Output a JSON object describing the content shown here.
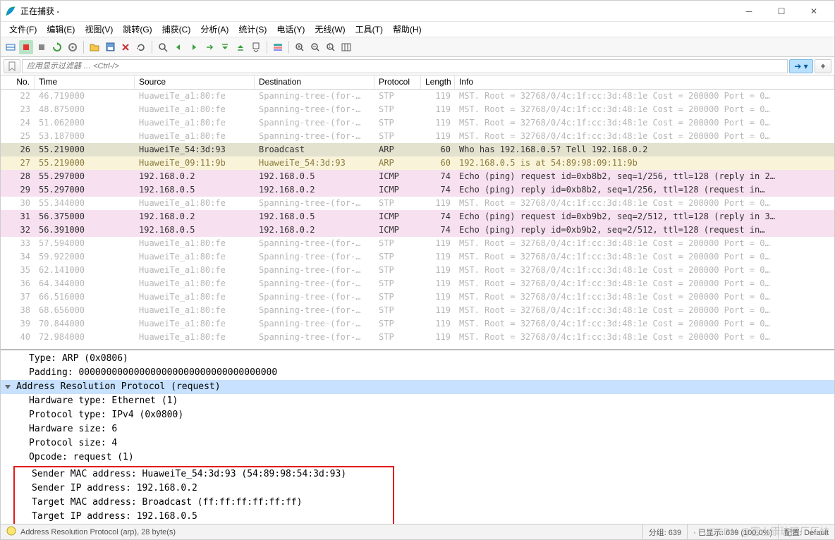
{
  "window": {
    "title": "正在捕获 -"
  },
  "menu": [
    "文件(F)",
    "编辑(E)",
    "视图(V)",
    "跳转(G)",
    "捕获(C)",
    "分析(A)",
    "统计(S)",
    "电话(Y)",
    "无线(W)",
    "工具(T)",
    "帮助(H)"
  ],
  "filter": {
    "placeholder": "应用显示过滤器 … <Ctrl-/>"
  },
  "columns": [
    "No.",
    "Time",
    "Source",
    "Destination",
    "Protocol",
    "Length",
    "Info"
  ],
  "packets": [
    {
      "no": "22",
      "time": "46.719000",
      "src": "HuaweiTe_a1:80:fe",
      "dst": "Spanning-tree-(for-…",
      "proto": "STP",
      "len": "119",
      "info": "MST. Root = 32768/0/4c:1f:cc:3d:48:1e  Cost = 200000  Port = 0…",
      "cls": "dim"
    },
    {
      "no": "23",
      "time": "48.875000",
      "src": "HuaweiTe_a1:80:fe",
      "dst": "Spanning-tree-(for-…",
      "proto": "STP",
      "len": "119",
      "info": "MST. Root = 32768/0/4c:1f:cc:3d:48:1e  Cost = 200000  Port = 0…",
      "cls": "dim"
    },
    {
      "no": "24",
      "time": "51.062000",
      "src": "HuaweiTe_a1:80:fe",
      "dst": "Spanning-tree-(for-…",
      "proto": "STP",
      "len": "119",
      "info": "MST. Root = 32768/0/4c:1f:cc:3d:48:1e  Cost = 200000  Port = 0…",
      "cls": "dim"
    },
    {
      "no": "25",
      "time": "53.187000",
      "src": "HuaweiTe_a1:80:fe",
      "dst": "Spanning-tree-(for-…",
      "proto": "STP",
      "len": "119",
      "info": "MST. Root = 32768/0/4c:1f:cc:3d:48:1e  Cost = 200000  Port = 0…",
      "cls": "dim"
    },
    {
      "no": "26",
      "time": "55.219000",
      "src": "HuaweiTe_54:3d:93",
      "dst": "Broadcast",
      "proto": "ARP",
      "len": "60",
      "info": "Who has 192.168.0.5? Tell 192.168.0.2",
      "cls": "arp0"
    },
    {
      "no": "27",
      "time": "55.219000",
      "src": "HuaweiTe_09:11:9b",
      "dst": "HuaweiTe_54:3d:93",
      "proto": "ARP",
      "len": "60",
      "info": "192.168.0.5 is at 54:89:98:09:11:9b",
      "cls": "arp1"
    },
    {
      "no": "28",
      "time": "55.297000",
      "src": "192.168.0.2",
      "dst": "192.168.0.5",
      "proto": "ICMP",
      "len": "74",
      "info": "Echo (ping) request  id=0xb8b2, seq=1/256, ttl=128 (reply in 2…",
      "cls": "icmp"
    },
    {
      "no": "29",
      "time": "55.297000",
      "src": "192.168.0.5",
      "dst": "192.168.0.2",
      "proto": "ICMP",
      "len": "74",
      "info": "Echo (ping) reply    id=0xb8b2, seq=1/256, ttl=128 (request in…",
      "cls": "icmp"
    },
    {
      "no": "30",
      "time": "55.344000",
      "src": "HuaweiTe_a1:80:fe",
      "dst": "Spanning-tree-(for-…",
      "proto": "STP",
      "len": "119",
      "info": "MST. Root = 32768/0/4c:1f:cc:3d:48:1e  Cost = 200000  Port = 0…",
      "cls": "dim"
    },
    {
      "no": "31",
      "time": "56.375000",
      "src": "192.168.0.2",
      "dst": "192.168.0.5",
      "proto": "ICMP",
      "len": "74",
      "info": "Echo (ping) request  id=0xb9b2, seq=2/512, ttl=128 (reply in 3…",
      "cls": "icmp"
    },
    {
      "no": "32",
      "time": "56.391000",
      "src": "192.168.0.5",
      "dst": "192.168.0.2",
      "proto": "ICMP",
      "len": "74",
      "info": "Echo (ping) reply    id=0xb9b2, seq=2/512, ttl=128 (request in…",
      "cls": "icmp"
    },
    {
      "no": "33",
      "time": "57.594000",
      "src": "HuaweiTe_a1:80:fe",
      "dst": "Spanning-tree-(for-…",
      "proto": "STP",
      "len": "119",
      "info": "MST. Root = 32768/0/4c:1f:cc:3d:48:1e  Cost = 200000  Port = 0…",
      "cls": "dim"
    },
    {
      "no": "34",
      "time": "59.922000",
      "src": "HuaweiTe_a1:80:fe",
      "dst": "Spanning-tree-(for-…",
      "proto": "STP",
      "len": "119",
      "info": "MST. Root = 32768/0/4c:1f:cc:3d:48:1e  Cost = 200000  Port = 0…",
      "cls": "dim"
    },
    {
      "no": "35",
      "time": "62.141000",
      "src": "HuaweiTe_a1:80:fe",
      "dst": "Spanning-tree-(for-…",
      "proto": "STP",
      "len": "119",
      "info": "MST. Root = 32768/0/4c:1f:cc:3d:48:1e  Cost = 200000  Port = 0…",
      "cls": "dim"
    },
    {
      "no": "36",
      "time": "64.344000",
      "src": "HuaweiTe_a1:80:fe",
      "dst": "Spanning-tree-(for-…",
      "proto": "STP",
      "len": "119",
      "info": "MST. Root = 32768/0/4c:1f:cc:3d:48:1e  Cost = 200000  Port = 0…",
      "cls": "dim"
    },
    {
      "no": "37",
      "time": "66.516000",
      "src": "HuaweiTe_a1:80:fe",
      "dst": "Spanning-tree-(for-…",
      "proto": "STP",
      "len": "119",
      "info": "MST. Root = 32768/0/4c:1f:cc:3d:48:1e  Cost = 200000  Port = 0…",
      "cls": "dim"
    },
    {
      "no": "38",
      "time": "68.656000",
      "src": "HuaweiTe_a1:80:fe",
      "dst": "Spanning-tree-(for-…",
      "proto": "STP",
      "len": "119",
      "info": "MST. Root = 32768/0/4c:1f:cc:3d:48:1e  Cost = 200000  Port = 0…",
      "cls": "dim"
    },
    {
      "no": "39",
      "time": "70.844000",
      "src": "HuaweiTe_a1:80:fe",
      "dst": "Spanning-tree-(for-…",
      "proto": "STP",
      "len": "119",
      "info": "MST. Root = 32768/0/4c:1f:cc:3d:48:1e  Cost = 200000  Port = 0…",
      "cls": "dim"
    },
    {
      "no": "40",
      "time": "72.984000",
      "src": "HuaweiTe_a1:80:fe",
      "dst": "Spanning-tree-(for-…",
      "proto": "STP",
      "len": "119",
      "info": "MST. Root = 32768/0/4c:1f:cc:3d:48:1e  Cost = 200000  Port = 0…",
      "cls": "dim"
    }
  ],
  "details_top": [
    "Type: ARP (0x0806)",
    "Padding: 000000000000000000000000000000000000"
  ],
  "details_hdr": "Address Resolution Protocol (request)",
  "details_body": [
    "Hardware type: Ethernet (1)",
    "Protocol type: IPv4 (0x0800)",
    "Hardware size: 6",
    "Protocol size: 4",
    "Opcode: request (1)"
  ],
  "details_boxed": [
    "Sender MAC address: HuaweiTe_54:3d:93 (54:89:98:54:3d:93)",
    "Sender IP address: 192.168.0.2",
    "Target MAC address: Broadcast (ff:ff:ff:ff:ff:ff)",
    "Target IP address: 192.168.0.5"
  ],
  "status": {
    "left": "Address Resolution Protocol (arp), 28 byte(s)",
    "pkts": "分组: 639",
    "disp": "· 已显示: 639 (100.0%)",
    "profile": "配置: Default"
  },
  "watermark": "CSDN @富士康玻璃厂厂妹"
}
